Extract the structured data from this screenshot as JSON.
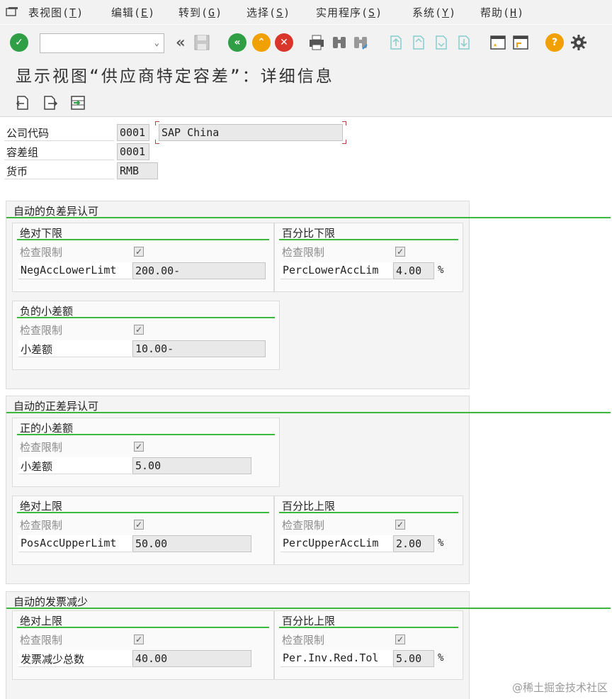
{
  "menu": [
    {
      "label": "表视图(",
      "key": "T",
      "end": ")"
    },
    {
      "label": "编辑(",
      "key": "E",
      "end": ")"
    },
    {
      "label": "转到(",
      "key": "G",
      "end": ")"
    },
    {
      "label": "选择(",
      "key": "S",
      "end": ")"
    },
    {
      "label": "实用程序(",
      "key": "S",
      "end": ")"
    },
    {
      "label": "系统(",
      "key": "Y",
      "end": ")"
    },
    {
      "label": "帮助(",
      "key": "H",
      "end": ")"
    }
  ],
  "title": "显示视图“供应商特定容差”：详细信息",
  "header": {
    "company_code_label": "公司代码",
    "company_code": "0001",
    "company_name": "SAP China",
    "tolerance_group_label": "容差组",
    "tolerance_group": "0001",
    "currency_label": "货币",
    "currency": "RMB"
  },
  "g1": {
    "title": "自动的负差异认可",
    "abs_lower": {
      "title": "绝对下限",
      "check_label": "检查限制",
      "field_label": "NegAccLowerLimt",
      "value": "200.00-"
    },
    "pct_lower": {
      "title": "百分比下限",
      "check_label": "检查限制",
      "field_label": "PercLowerAccLim",
      "value": "4.00",
      "unit": "%"
    },
    "small_neg": {
      "title": "负的小差额",
      "check_label": "检查限制",
      "field_label": "小差额",
      "value": "10.00-"
    }
  },
  "g2": {
    "title": "自动的正差异认可",
    "small_pos": {
      "title": "正的小差额",
      "check_label": "检查限制",
      "field_label": "小差额",
      "value": "5.00"
    },
    "abs_upper": {
      "title": "绝对上限",
      "check_label": "检查限制",
      "field_label": "PosAccUpperLimt",
      "value": "50.00"
    },
    "pct_upper": {
      "title": "百分比上限",
      "check_label": "检查限制",
      "field_label": "PercUpperAccLim",
      "value": "2.00",
      "unit": "%"
    }
  },
  "g3": {
    "title": "自动的发票减少",
    "abs_upper": {
      "title": "绝对上限",
      "check_label": "检查限制",
      "field_label": "发票减少总数",
      "value": "40.00"
    },
    "pct_upper": {
      "title": "百分比上限",
      "check_label": "检查限制",
      "field_label": "Per.Inv.Red.Tol",
      "value": "5.00",
      "unit": "%"
    }
  },
  "checkmark": "✓",
  "watermark": "@稀土掘金技术社区"
}
